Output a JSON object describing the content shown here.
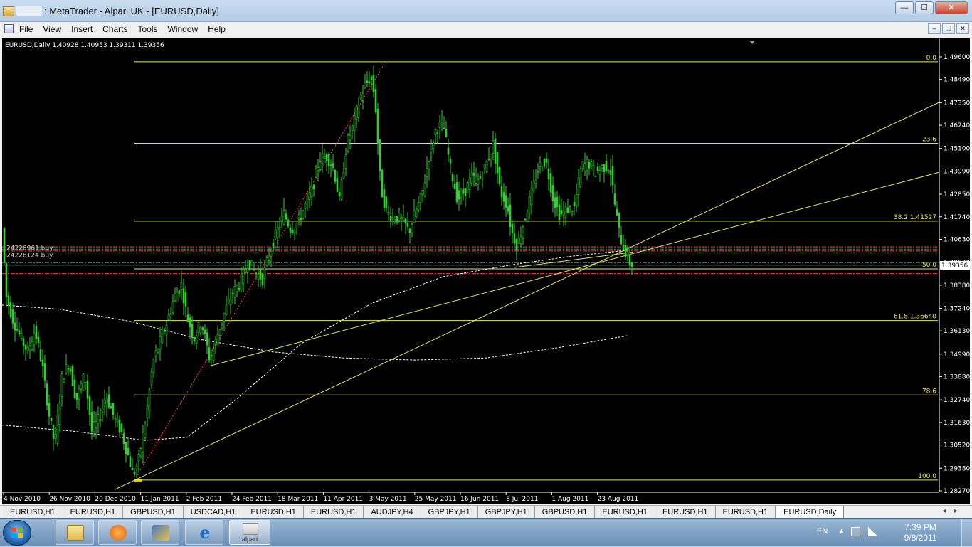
{
  "window": {
    "title": ": MetaTrader - Alpari UK - [EURUSD,Daily]",
    "buttons": {
      "minimize": "—",
      "maximize": "☐",
      "close": "✕"
    },
    "mdi_buttons": {
      "minimize": "–",
      "restore": "❐",
      "close": "✕"
    }
  },
  "menu": [
    "File",
    "View",
    "Insert",
    "Charts",
    "Tools",
    "Window",
    "Help"
  ],
  "chart": {
    "info_text": "EURUSD,Daily  1.40928 1.40953 1.39311 1.39356",
    "current_price": "1.39356",
    "order_labels": [
      "24226961 buy",
      "24228124 buy"
    ],
    "fib_labels": [
      {
        "text": "0.0",
        "price": 1.4936
      },
      {
        "text": "23.6",
        "price": 1.4535
      },
      {
        "text": "38.2 1.41527",
        "price": 1.41527
      },
      {
        "text": "50.0",
        "price": 1.3918
      },
      {
        "text": "61.8 1.36640",
        "price": 1.3664
      },
      {
        "text": "78.6",
        "price": 1.3298
      },
      {
        "text": "100.0",
        "price": 1.288
      }
    ],
    "colors": {
      "background": "#000000",
      "candles": "#32cd32",
      "fib": "#e6e665",
      "ma": "#ffffff",
      "order_green": "#2e8b57",
      "order_red": "#ff3b30",
      "axis_text": "#ffffff",
      "price_box": "#ffffff"
    }
  },
  "chart_data": {
    "type": "candlestick",
    "symbol": "EURUSD",
    "timeframe": "Daily",
    "ohlc_last": {
      "open": 1.40928,
      "high": 1.40953,
      "low": 1.39311,
      "close": 1.39356
    },
    "y_ticks": [
      "1.49600",
      "1.48490",
      "1.47350",
      "1.46240",
      "1.45100",
      "1.43990",
      "1.42850",
      "1.41740",
      "1.40630",
      "1.39500",
      "1.38380",
      "1.37240",
      "1.36130",
      "1.34990",
      "1.33880",
      "1.32740",
      "1.31630",
      "1.30520",
      "1.29380",
      "1.28270"
    ],
    "x_ticks": [
      "4 Nov 2010",
      "26 Nov 2010",
      "20 Dec 2010",
      "11 Jan 2011",
      "2 Feb 2011",
      "24 Feb 2011",
      "18 Mar 2011",
      "11 Apr 2011",
      "3 May 2011",
      "25 May 2011",
      "16 Jun 2011",
      "8 Jul 2011",
      "1 Aug 2011",
      "23 Aug 2011"
    ],
    "ylim": [
      1.2827,
      1.496
    ],
    "trend_path": [
      [
        0,
        1.423
      ],
      [
        8,
        1.378
      ],
      [
        18,
        1.366
      ],
      [
        28,
        1.358
      ],
      [
        38,
        1.351
      ],
      [
        48,
        1.362
      ],
      [
        58,
        1.345
      ],
      [
        68,
        1.32
      ],
      [
        76,
        1.305
      ],
      [
        86,
        1.338
      ],
      [
        96,
        1.346
      ],
      [
        106,
        1.327
      ],
      [
        118,
        1.34
      ],
      [
        128,
        1.312
      ],
      [
        138,
        1.318
      ],
      [
        148,
        1.33
      ],
      [
        158,
        1.32
      ],
      [
        170,
        1.311
      ],
      [
        180,
        1.299
      ],
      [
        186,
        1.29
      ],
      [
        194,
        1.298
      ],
      [
        204,
        1.318
      ],
      [
        214,
        1.346
      ],
      [
        224,
        1.356
      ],
      [
        234,
        1.366
      ],
      [
        244,
        1.378
      ],
      [
        254,
        1.384
      ],
      [
        262,
        1.368
      ],
      [
        272,
        1.358
      ],
      [
        282,
        1.366
      ],
      [
        294,
        1.347
      ],
      [
        306,
        1.361
      ],
      [
        316,
        1.372
      ],
      [
        326,
        1.38
      ],
      [
        338,
        1.386
      ],
      [
        348,
        1.396
      ],
      [
        358,
        1.39
      ],
      [
        368,
        1.387
      ],
      [
        378,
        1.4
      ],
      [
        388,
        1.41
      ],
      [
        398,
        1.419
      ],
      [
        408,
        1.411
      ],
      [
        418,
        1.415
      ],
      [
        428,
        1.423
      ],
      [
        438,
        1.431
      ],
      [
        448,
        1.446
      ],
      [
        458,
        1.447
      ],
      [
        468,
        1.441
      ],
      [
        476,
        1.425
      ],
      [
        486,
        1.453
      ],
      [
        496,
        1.463
      ],
      [
        504,
        1.475
      ],
      [
        512,
        1.482
      ],
      [
        520,
        1.486
      ],
      [
        526,
        1.476
      ],
      [
        534,
        1.432
      ],
      [
        542,
        1.42
      ],
      [
        550,
        1.417
      ],
      [
        558,
        1.417
      ],
      [
        566,
        1.415
      ],
      [
        574,
        1.41
      ],
      [
        582,
        1.419
      ],
      [
        592,
        1.428
      ],
      [
        602,
        1.447
      ],
      [
        612,
        1.461
      ],
      [
        622,
        1.463
      ],
      [
        632,
        1.441
      ],
      [
        642,
        1.426
      ],
      [
        652,
        1.43
      ],
      [
        662,
        1.437
      ],
      [
        672,
        1.435
      ],
      [
        682,
        1.443
      ],
      [
        692,
        1.453
      ],
      [
        702,
        1.43
      ],
      [
        712,
        1.423
      ],
      [
        718,
        1.41
      ],
      [
        726,
        1.403
      ],
      [
        736,
        1.416
      ],
      [
        746,
        1.429
      ],
      [
        756,
        1.442
      ],
      [
        766,
        1.445
      ],
      [
        776,
        1.427
      ],
      [
        786,
        1.418
      ],
      [
        796,
        1.421
      ],
      [
        806,
        1.422
      ],
      [
        816,
        1.442
      ],
      [
        826,
        1.444
      ],
      [
        836,
        1.439
      ],
      [
        846,
        1.442
      ],
      [
        856,
        1.442
      ],
      [
        864,
        1.421
      ],
      [
        870,
        1.408
      ],
      [
        876,
        1.402
      ],
      [
        882,
        1.396
      ],
      [
        886,
        1.394
      ]
    ]
  },
  "tabs": [
    "EURUSD,H1",
    "EURUSD,H1",
    "GBPUSD,H1",
    "USDCAD,H1",
    "EURUSD,H1",
    "EURUSD,H1",
    "AUDJPY,H4",
    "GBPJPY,H1",
    "GBPJPY,H1",
    "GBPUSD,H1",
    "EURUSD,H1",
    "EURUSD,H1",
    "EURUSD,H1",
    "EURUSD,Daily"
  ],
  "active_tab": 13,
  "taskbar": {
    "apps": [
      "explorer-icon",
      "media-player-icon",
      "network-tool-icon",
      "internet-explorer-icon",
      "alpari-icon"
    ],
    "alpari_label": "alpari",
    "lang": "EN",
    "time": "7:39 PM",
    "date": "9/8/2011"
  }
}
